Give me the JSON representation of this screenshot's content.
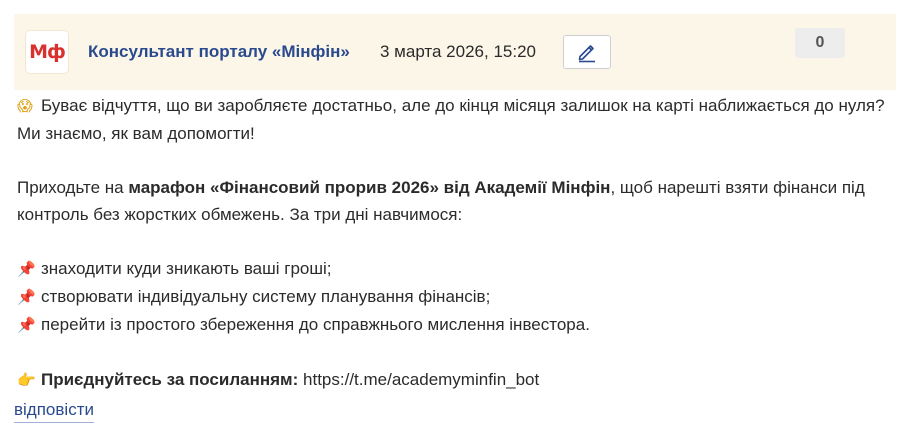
{
  "comment": {
    "logo_text": "Мф",
    "author": "Консультант порталу «Мінфін»",
    "date": "3 марта 2026, 15:20",
    "edit_icon": "pencil-icon",
    "vote_count": "0"
  },
  "message": {
    "intro_emoji": "😱",
    "intro_text": "Буває відчуття, що ви заробляєте достатньо, але до кінця місяця залишок на карті наближається до нуля? Ми знаємо, як вам допомогти!",
    "invite_prefix": "Приходьте на ",
    "invite_bold": "марафон «Фінансовий прорив 2026» від Академії Мінфін",
    "invite_suffix": ", щоб нарешті взяти фінанси під контроль без жорстких обмежень. За три дні навчимося:",
    "bullet_emoji": "📌",
    "bullets": [
      "знаходити куди зникають ваші гроші;",
      "створювати індивідуальну систему планування фінансів;",
      "перейти із простого збереження до справжнього мислення інвестора."
    ],
    "cta_emoji": "👉",
    "cta_bold": "Приєднуйтесь за посиланням:",
    "cta_link": "https://t.me/academyminfin_bot"
  },
  "actions": {
    "reply_label": "відповісти"
  },
  "colors": {
    "header_bg": "#fcf6e9",
    "author": "#2a4a8e",
    "logo": "#d9322e",
    "link": "#2a4a8e"
  }
}
